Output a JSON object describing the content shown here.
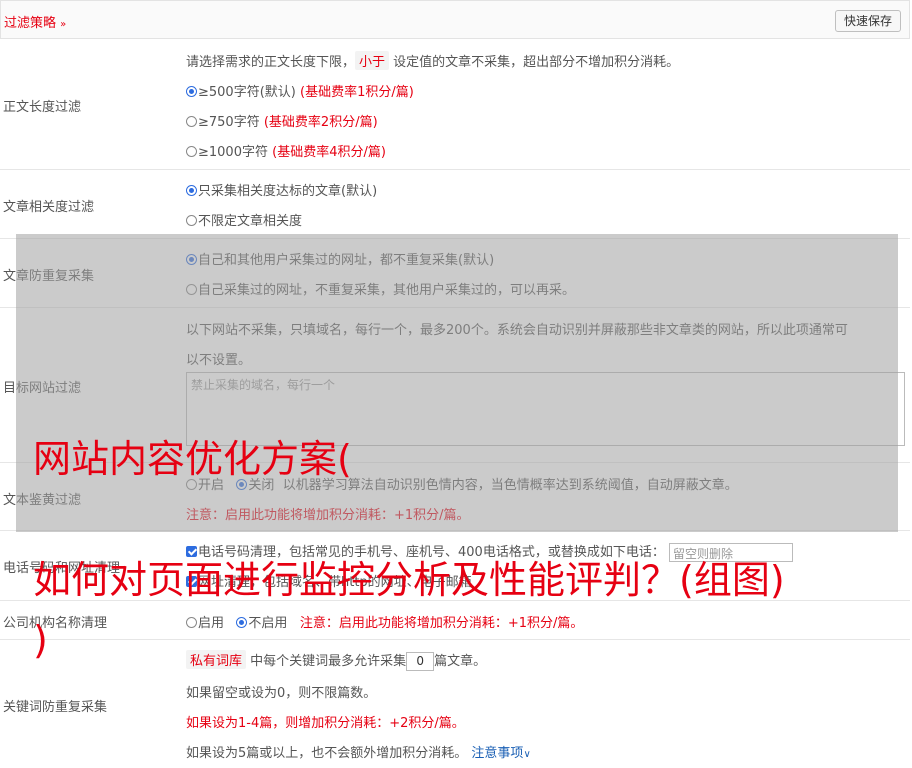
{
  "header": {
    "title": "过滤策略",
    "save_label": "快速保存"
  },
  "length_filter": {
    "label": "正文长度过滤",
    "intro_pre": "请选择需求的正文长度下限，",
    "intro_tag": "小于",
    "intro_post": "设定值的文章不采集，超出部分不增加积分消耗。",
    "options": [
      {
        "text": "≥500字符(默认)",
        "note": "(基础费率1积分/篇)",
        "selected": true
      },
      {
        "text": "≥750字符",
        "note": "(基础费率2积分/篇)",
        "selected": false
      },
      {
        "text": "≥1000字符",
        "note": "(基础费率4积分/篇)",
        "selected": false
      }
    ]
  },
  "relevance": {
    "label": "文章相关度过滤",
    "options": [
      {
        "text": "只采集相关度达标的文章(默认)",
        "selected": true
      },
      {
        "text": "不限定文章相关度",
        "selected": false
      }
    ]
  },
  "dedupe": {
    "label": "文章防重复采集",
    "options": [
      {
        "text": "自己和其他用户采集过的网址，都不重复采集(默认)",
        "selected": true
      },
      {
        "text": "自己采集过的网址，不重复采集，其他用户采集过的，可以再采。",
        "selected": false
      }
    ]
  },
  "site_filter": {
    "label": "目标网站过滤",
    "desc_line1": "以下网站不采集，只填域名，每行一个，最多200个。系统会自动识别并屏蔽那些非文章类的网站，所以此项通常可",
    "desc_line2": "以不设置。",
    "placeholder": "禁止采集的域名，每行一个"
  },
  "porn_filter": {
    "label": "文本鉴黄过滤",
    "on_label": "开启",
    "off_label": "关闭",
    "desc": "以机器学习算法自动识别色情内容，当色情概率达到系统阈值，自动屏蔽文章。",
    "note": "注意：启用此功能将增加积分消耗：+1积分/篇。"
  },
  "phone_clean": {
    "label": "电话号码和网址清理",
    "line1": "电话号码清理，包括常见的手机号、座机号、400电话格式，或替换成如下电话：",
    "phone_placeholder": "留空则删除",
    "line2": "网址清理，包括域名、带http的网址、电子邮箱"
  },
  "company_clean": {
    "label": "公司机构名称清理",
    "on_label": "启用",
    "off_label": "不启用",
    "note": "注意：启用此功能将增加积分消耗：+1积分/篇。"
  },
  "keyword_dedupe": {
    "label": "关键词防重复采集",
    "tag": "私有词库",
    "line1_mid": "中每个关键词最多允许采集",
    "count_value": "0",
    "line1_post": "篇文章。",
    "line2": "如果留空或设为0，则不限篇数。",
    "line3": "如果设为1-4篇，则增加积分消耗：+2积分/篇。",
    "line4": "如果设为5篇或以上，也不会额外增加积分消耗。",
    "link": "注意事项"
  },
  "watermark": {
    "line1": "网站内容优化方案(",
    "line2": "如何对页面进行监控分析及性能评判？(组图)",
    "line3": ")"
  }
}
